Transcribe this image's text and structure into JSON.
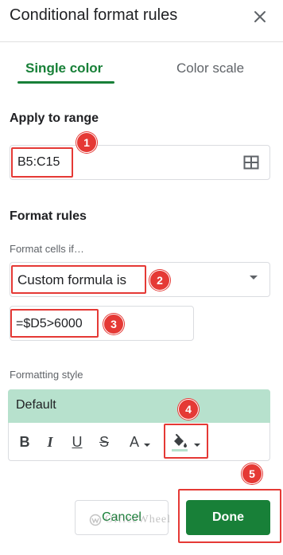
{
  "panel": {
    "title": "Conditional format rules",
    "close_icon": "close-icon"
  },
  "tabs": [
    {
      "label": "Single color",
      "active": true
    },
    {
      "label": "Color scale",
      "active": false
    }
  ],
  "apply_range": {
    "heading": "Apply to range",
    "value": "B5:C15",
    "icon": "grid-select-icon"
  },
  "format_rules": {
    "heading": "Format rules",
    "condition_label": "Format cells if…",
    "condition_value": "Custom formula is",
    "formula_value": "=$D5>6000"
  },
  "formatting_style": {
    "label": "Formatting style",
    "preview_text": "Default",
    "preview_color": "#b7e1cd",
    "fill_color": "#b7e1cd",
    "toolbar": {
      "bold": "B",
      "italic": "I",
      "underline": "U",
      "strikethrough": "S",
      "text_color": "A"
    }
  },
  "actions": {
    "cancel_label": "Cancel",
    "done_label": "Done"
  },
  "annotations": [
    "1",
    "2",
    "3",
    "4",
    "5"
  ],
  "watermark": {
    "text": "OfficeWheel"
  },
  "colors": {
    "accent": "#188038",
    "annotation": "#e53935"
  }
}
